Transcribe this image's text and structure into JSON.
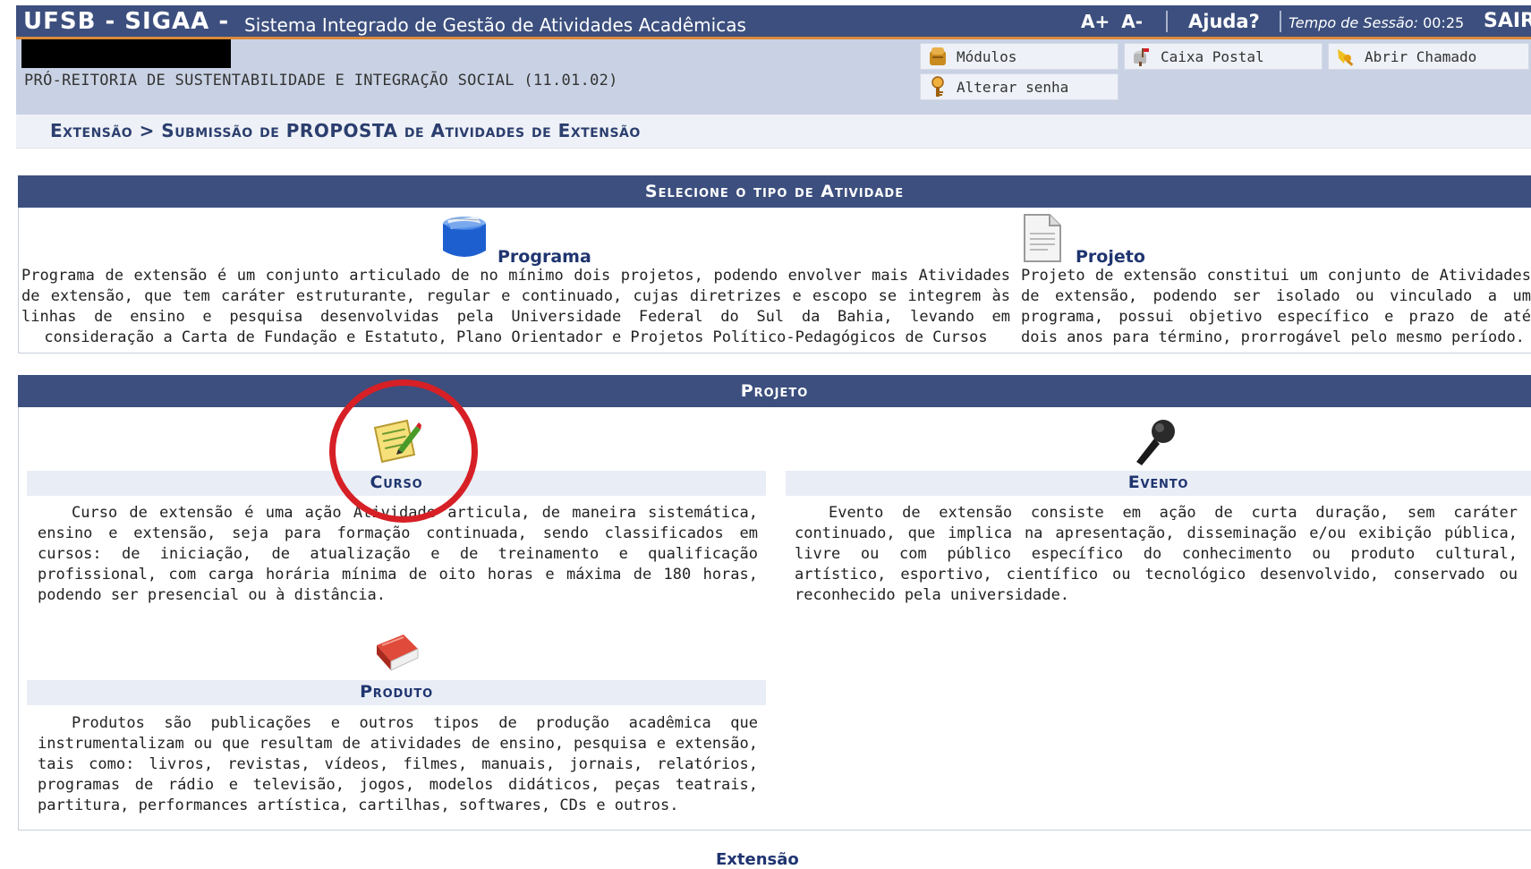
{
  "topbar": {
    "brand": "UFSB - SIGAA -",
    "system_title": "Sistema Integrado de Gestão de Atividades Acadêmicas",
    "font_increase": "A+",
    "font_decrease": "A-",
    "help": "Ajuda?",
    "session_label": "Tempo de Sessão:",
    "session_time": "00:25",
    "logout": "SAIR",
    "bar_color": "#3c4f7e",
    "accent_color": "#d98a3a"
  },
  "user": {
    "unit": "PRÓ-REITORIA DE SUSTENTABILIDADE E INTEGRAÇÃO SOCIAL (11.01.02)"
  },
  "menu": {
    "modules": {
      "label": "Módulos",
      "icon": "modules-icon"
    },
    "mailbox": {
      "label": "Caixa Postal",
      "icon": "mailbox-icon"
    },
    "ticket": {
      "label": "Abrir Chamado",
      "icon": "ticket-icon"
    },
    "change_password": {
      "label": "Alterar senha",
      "icon": "password-icon"
    }
  },
  "breadcrumb": {
    "text": "Extensão > Submissão de PROPOSTA de Atividades de Extensão"
  },
  "select_section": {
    "header": "Selecione o tipo de Atividade",
    "programa": {
      "title": "Programa",
      "description": "Programa de extensão é um conjunto articulado de no mínimo dois projetos, podendo envolver mais Atividades de extensão, que tem caráter estruturante, regular e continuado, cujas diretrizes e escopo se integrem às linhas de ensino e pesquisa desenvolvidas pela Universidade Federal do Sul da Bahia, levando em consideração a Carta de Fundação e Estatuto, Plano Orientador e Projetos Político-Pedagógicos de Cursos"
    },
    "projeto": {
      "title": "Projeto",
      "description": "Projeto de extensão constitui um conjunto de Atividades de extensão, podendo ser isolado ou vinculado a um programa, possui objetivo específico e prazo de até dois anos para término, prorrogável pelo mesmo período."
    }
  },
  "projeto_section": {
    "header": "Projeto",
    "curso": {
      "title": "Curso",
      "description": "Curso de extensão é uma ação Atividade articula, de maneira sistemática, ensino e extensão, seja para formação continuada, sendo classificados em cursos: de iniciação, de atualização e de treinamento e qualificação profissional, com carga horária mínima de oito horas e máxima de 180 horas, podendo ser presencial ou à distância."
    },
    "evento": {
      "title": "Evento",
      "description": "Evento de extensão consiste em ação de curta duração, sem caráter continuado, que implica na apresentação, disseminação e/ou exibição pública, livre ou com público específico do conhecimento ou produto cultural, artístico, esportivo, científico ou tecnológico desenvolvido, conservado ou reconhecido pela universidade."
    },
    "produto": {
      "title": "Produto",
      "description": "Produtos são publicações e outros tipos de produção acadêmica que instrumentalizam ou que resultam de atividades de ensino, pesquisa e extensão, tais como: livros, revistas, vídeos, filmes, manuais, jornais, relatórios, programas de rádio e televisão, jogos, modelos didáticos, peças teatrais, partitura, performances artística, cartilhas, softwares, CDs e outros."
    }
  },
  "footer": {
    "link": "Extensão"
  }
}
